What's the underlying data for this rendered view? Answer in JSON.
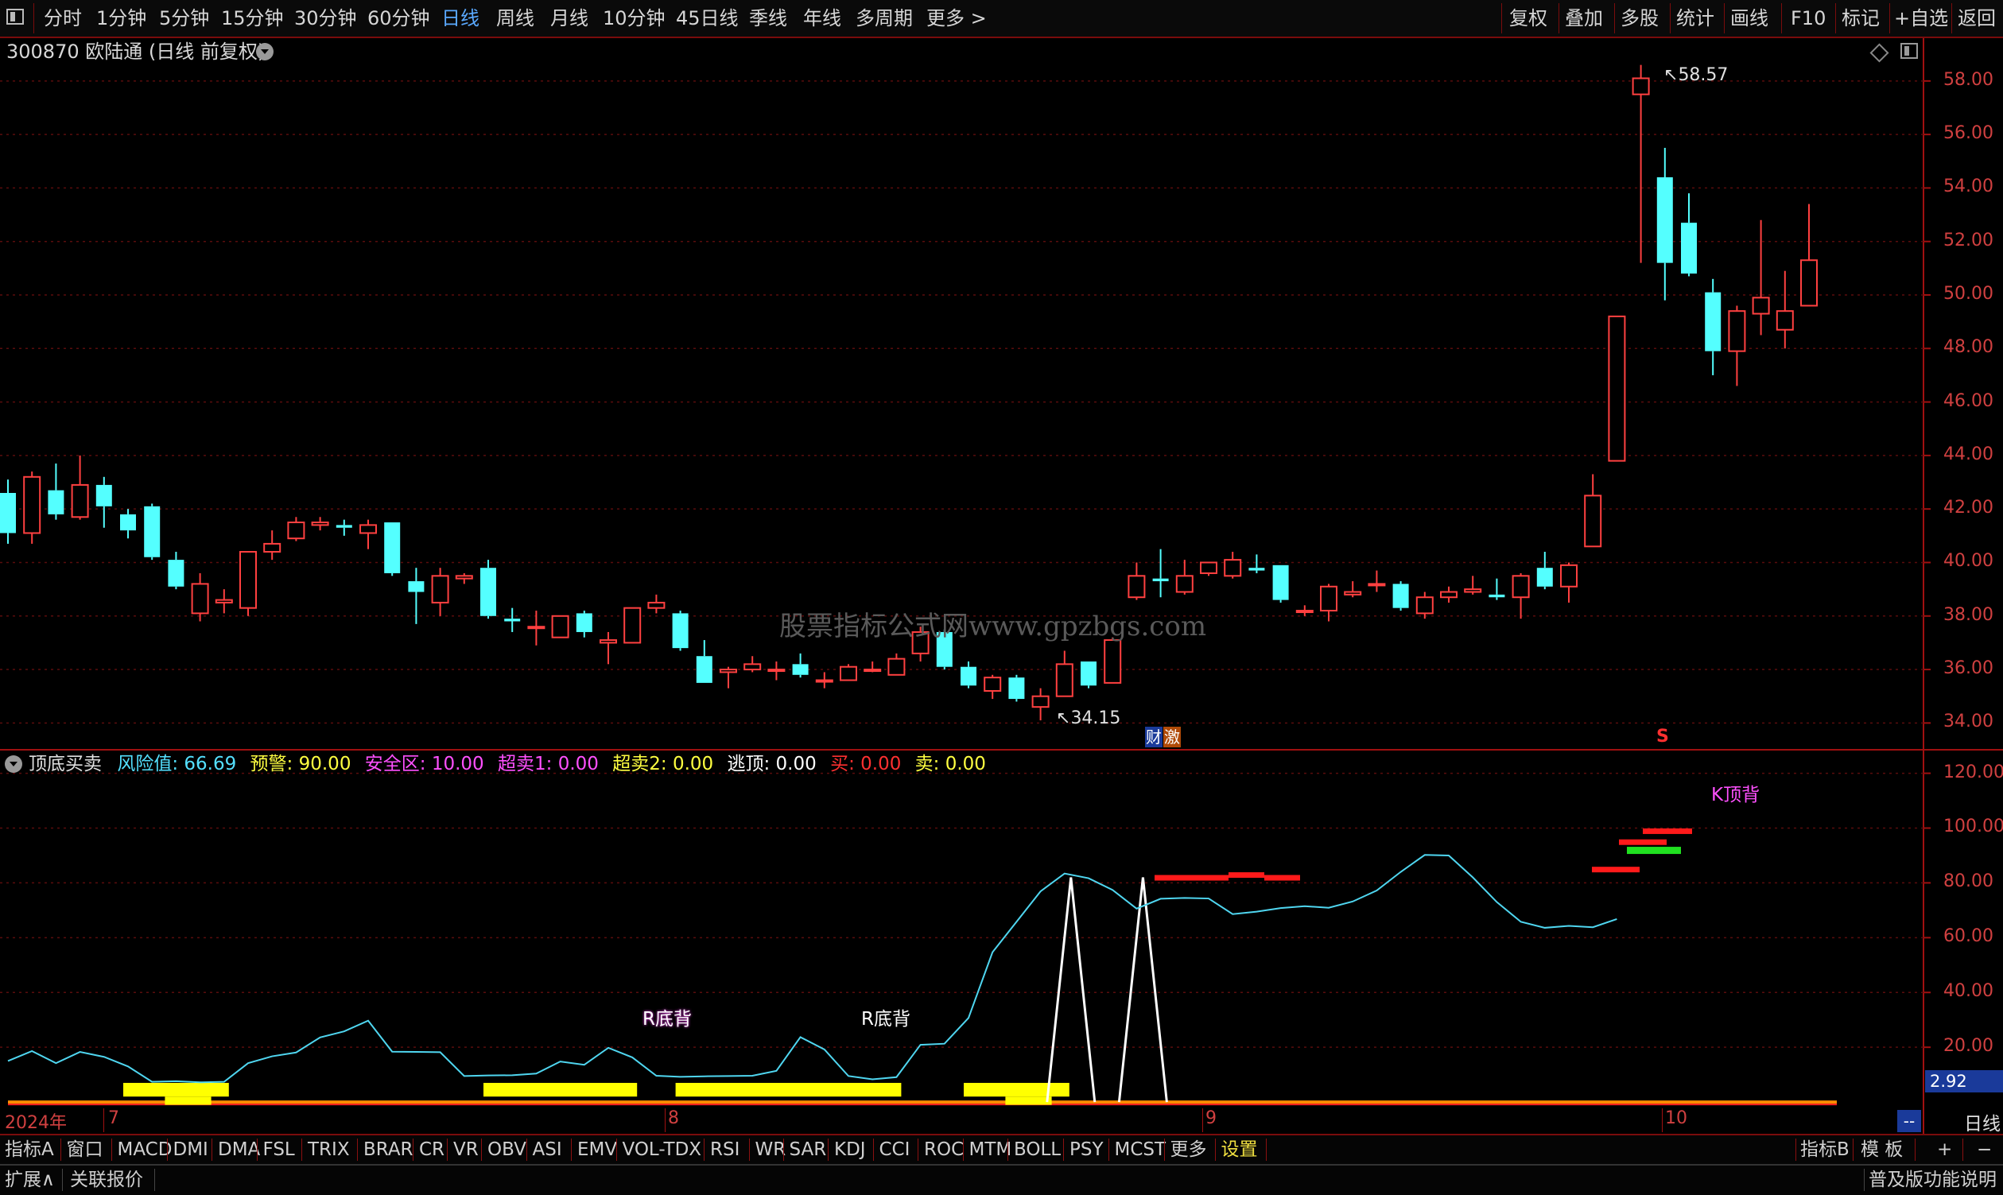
{
  "topbar": {
    "periods": [
      "分时",
      "1分钟",
      "5分钟",
      "15分钟",
      "30分钟",
      "60分钟",
      "日线",
      "周线",
      "月线",
      "10分钟",
      "45日线",
      "季线",
      "年线",
      "多周期",
      "更多 >"
    ],
    "active_period": "日线",
    "right_buttons": [
      "复权",
      "叠加",
      "多股",
      "统计",
      "画线",
      "F10",
      "标记",
      "+自选",
      "返回"
    ]
  },
  "main_chart": {
    "title": "300870 欧陆通 (日线 前复权)",
    "high_label": "58.57",
    "low_label": "34.15",
    "watermark": "股票指标公式网www.gpzbgs.com",
    "marker_cai": "财",
    "marker_ji": "激",
    "marker_s": "S",
    "y_ticks": [
      "58.00",
      "56.00",
      "54.00",
      "52.00",
      "50.00",
      "48.00",
      "46.00",
      "44.00",
      "42.00",
      "40.00",
      "38.00",
      "36.00",
      "34.00"
    ],
    "up_color": "#ff4040",
    "down_color": "#54ffff"
  },
  "chart_data": [
    {
      "type": "candlestick",
      "ylim": [
        33.0,
        59.6
      ],
      "candles": [
        {
          "o": 42.6,
          "c": 41.1,
          "h": 43.1,
          "l": 40.7
        },
        {
          "o": 41.1,
          "c": 43.2,
          "h": 43.4,
          "l": 40.7
        },
        {
          "o": 42.7,
          "c": 41.8,
          "h": 43.7,
          "l": 41.6
        },
        {
          "o": 41.7,
          "c": 42.9,
          "h": 44.0,
          "l": 41.6
        },
        {
          "o": 42.9,
          "c": 42.1,
          "h": 43.2,
          "l": 41.3
        },
        {
          "o": 41.8,
          "c": 41.2,
          "h": 42.0,
          "l": 40.9
        },
        {
          "o": 42.1,
          "c": 40.2,
          "h": 42.2,
          "l": 40.1
        },
        {
          "o": 40.1,
          "c": 39.1,
          "h": 40.4,
          "l": 39.0
        },
        {
          "o": 38.1,
          "c": 39.2,
          "h": 39.6,
          "l": 37.8
        },
        {
          "o": 38.5,
          "c": 38.6,
          "h": 39.0,
          "l": 38.1
        },
        {
          "o": 38.3,
          "c": 40.4,
          "h": 40.4,
          "l": 38.0
        },
        {
          "o": 40.4,
          "c": 40.7,
          "h": 41.2,
          "l": 40.1
        },
        {
          "o": 40.9,
          "c": 41.5,
          "h": 41.7,
          "l": 40.8
        },
        {
          "o": 41.4,
          "c": 41.5,
          "h": 41.7,
          "l": 41.2
        },
        {
          "o": 41.4,
          "c": 41.3,
          "h": 41.6,
          "l": 41.0
        },
        {
          "o": 41.1,
          "c": 41.4,
          "h": 41.6,
          "l": 40.5
        },
        {
          "o": 41.5,
          "c": 39.6,
          "h": 41.5,
          "l": 39.5
        },
        {
          "o": 39.3,
          "c": 38.9,
          "h": 39.8,
          "l": 37.7
        },
        {
          "o": 38.5,
          "c": 39.5,
          "h": 39.8,
          "l": 38.0
        },
        {
          "o": 39.4,
          "c": 39.5,
          "h": 39.6,
          "l": 39.2
        },
        {
          "o": 39.8,
          "c": 38.0,
          "h": 40.1,
          "l": 37.9
        },
        {
          "o": 37.9,
          "c": 37.8,
          "h": 38.3,
          "l": 37.4
        },
        {
          "o": 37.6,
          "c": 37.6,
          "h": 38.2,
          "l": 36.9
        },
        {
          "o": 37.2,
          "c": 38.0,
          "h": 38.0,
          "l": 37.2
        },
        {
          "o": 38.1,
          "c": 37.4,
          "h": 38.2,
          "l": 37.2
        },
        {
          "o": 37.0,
          "c": 37.1,
          "h": 37.4,
          "l": 36.2
        },
        {
          "o": 37.0,
          "c": 38.3,
          "h": 38.3,
          "l": 37.0
        },
        {
          "o": 38.3,
          "c": 38.5,
          "h": 38.8,
          "l": 38.1
        },
        {
          "o": 38.1,
          "c": 36.8,
          "h": 38.2,
          "l": 36.7
        },
        {
          "o": 36.5,
          "c": 35.5,
          "h": 37.1,
          "l": 35.5
        },
        {
          "o": 35.9,
          "c": 36.0,
          "h": 36.1,
          "l": 35.3
        },
        {
          "o": 36.0,
          "c": 36.2,
          "h": 36.5,
          "l": 35.9
        },
        {
          "o": 36.0,
          "c": 36.0,
          "h": 36.3,
          "l": 35.6
        },
        {
          "o": 36.2,
          "c": 35.8,
          "h": 36.6,
          "l": 35.7
        },
        {
          "o": 35.6,
          "c": 35.6,
          "h": 35.9,
          "l": 35.3
        },
        {
          "o": 35.6,
          "c": 36.1,
          "h": 36.2,
          "l": 35.6
        },
        {
          "o": 36.0,
          "c": 36.0,
          "h": 36.3,
          "l": 35.9
        },
        {
          "o": 35.8,
          "c": 36.4,
          "h": 36.6,
          "l": 35.8
        },
        {
          "o": 36.6,
          "c": 37.4,
          "h": 37.6,
          "l": 36.3
        },
        {
          "o": 37.4,
          "c": 36.1,
          "h": 37.5,
          "l": 36.0
        },
        {
          "o": 36.1,
          "c": 35.4,
          "h": 36.3,
          "l": 35.3
        },
        {
          "o": 35.2,
          "c": 35.7,
          "h": 35.8,
          "l": 34.9
        },
        {
          "o": 35.7,
          "c": 34.9,
          "h": 35.8,
          "l": 34.8
        },
        {
          "o": 34.6,
          "c": 35.0,
          "h": 35.3,
          "l": 34.1
        },
        {
          "o": 35.0,
          "c": 36.2,
          "h": 36.7,
          "l": 35.0
        },
        {
          "o": 36.3,
          "c": 35.4,
          "h": 36.3,
          "l": 35.3
        },
        {
          "o": 35.5,
          "c": 37.1,
          "h": 37.2,
          "l": 35.5
        },
        {
          "o": 38.7,
          "c": 39.5,
          "h": 40.0,
          "l": 38.6
        },
        {
          "o": 39.4,
          "c": 39.3,
          "h": 40.5,
          "l": 38.7
        },
        {
          "o": 38.9,
          "c": 39.5,
          "h": 40.1,
          "l": 38.8
        },
        {
          "o": 39.6,
          "c": 40.0,
          "h": 40.0,
          "l": 39.5
        },
        {
          "o": 39.5,
          "c": 40.1,
          "h": 40.4,
          "l": 39.4
        },
        {
          "o": 39.8,
          "c": 39.7,
          "h": 40.3,
          "l": 39.6
        },
        {
          "o": 39.9,
          "c": 38.6,
          "h": 39.9,
          "l": 38.5
        },
        {
          "o": 38.2,
          "c": 38.2,
          "h": 38.4,
          "l": 38.0
        },
        {
          "o": 38.2,
          "c": 39.1,
          "h": 39.2,
          "l": 37.8
        },
        {
          "o": 38.8,
          "c": 38.9,
          "h": 39.3,
          "l": 38.7
        },
        {
          "o": 39.2,
          "c": 39.2,
          "h": 39.7,
          "l": 38.9
        },
        {
          "o": 39.2,
          "c": 38.3,
          "h": 39.3,
          "l": 38.2
        },
        {
          "o": 38.1,
          "c": 38.7,
          "h": 38.9,
          "l": 37.9
        },
        {
          "o": 38.7,
          "c": 38.9,
          "h": 39.1,
          "l": 38.5
        },
        {
          "o": 38.9,
          "c": 39.0,
          "h": 39.5,
          "l": 38.8
        },
        {
          "o": 38.8,
          "c": 38.7,
          "h": 39.4,
          "l": 38.6
        },
        {
          "o": 38.7,
          "c": 39.5,
          "h": 39.6,
          "l": 37.9
        },
        {
          "o": 39.8,
          "c": 39.1,
          "h": 40.4,
          "l": 39.0
        },
        {
          "o": 39.1,
          "c": 39.9,
          "h": 40.0,
          "l": 38.5
        },
        {
          "o": 40.6,
          "c": 42.5,
          "h": 43.3,
          "l": 40.6
        },
        {
          "o": 43.8,
          "c": 49.2,
          "h": 49.2,
          "l": 43.8
        },
        {
          "o": 57.5,
          "c": 58.1,
          "h": 58.6,
          "l": 51.2
        },
        {
          "o": 54.4,
          "c": 51.2,
          "h": 55.5,
          "l": 49.8
        },
        {
          "o": 52.7,
          "c": 50.8,
          "h": 53.8,
          "l": 50.7
        },
        {
          "o": 50.1,
          "c": 47.9,
          "h": 50.6,
          "l": 47.0
        },
        {
          "o": 47.9,
          "c": 49.4,
          "h": 49.6,
          "l": 46.6
        },
        {
          "o": 49.3,
          "c": 49.9,
          "h": 52.8,
          "l": 48.5
        },
        {
          "o": 48.7,
          "c": 49.4,
          "h": 50.9,
          "l": 48.0
        },
        {
          "o": 49.6,
          "c": 51.3,
          "h": 53.4,
          "l": 49.6
        }
      ]
    },
    {
      "type": "line",
      "ylim": [
        -2,
        128
      ],
      "values": [
        15,
        18.6,
        14.2,
        18.3,
        16.5,
        13,
        7.4,
        7.6,
        7.2,
        7.4,
        14.2,
        16.7,
        18.1,
        23.6,
        25.8,
        29.7,
        18.4,
        18.3,
        18.2,
        9.5,
        9.7,
        9.8,
        10.4,
        14.8,
        13.6,
        19.8,
        16.3,
        9.6,
        9.2,
        9.4,
        9.5,
        9.6,
        11.4,
        23.7,
        19.2,
        9.5,
        8.3,
        9.1,
        20.9,
        21.3,
        30.7,
        54.7,
        65.8,
        76.9,
        83.4,
        81.7,
        77.4,
        70.6,
        74.2,
        74.5,
        74.3,
        68.6,
        69.5,
        70.8,
        71.5,
        70.9,
        73.2,
        77.2,
        84,
        90.2,
        90,
        82,
        73,
        65.8,
        63.6,
        64.3,
        63.8,
        66.8
      ],
      "x_labels": [
        "2024年",
        "7",
        "8",
        "9",
        "10"
      ]
    }
  ],
  "indicator": {
    "name": "顶底买卖",
    "items": [
      {
        "label": "风险值:",
        "value": "66.69"
      },
      {
        "label": "预警:",
        "value": "90.00"
      },
      {
        "label": "安全区:",
        "value": "10.00"
      },
      {
        "label": "超卖1:",
        "value": "0.00"
      },
      {
        "label": "超卖2:",
        "value": "0.00"
      },
      {
        "label": "逃顶:",
        "value": "0.00"
      },
      {
        "label": "买:",
        "value": "0.00"
      },
      {
        "label": "卖:",
        "value": "0.00"
      }
    ],
    "y_ticks": [
      "120.00",
      "100.00",
      "80.00",
      "60.00",
      "40.00",
      "20.00"
    ],
    "current_value": "2.92",
    "label_k_top": "K顶背",
    "label_r_bottom_1": "R底背",
    "label_r_bottom_2": "R底背",
    "x_axis": {
      "year": "2024年",
      "m7": "7",
      "m8": "8",
      "m9": "9",
      "m10": "10"
    },
    "period_label": "日线",
    "dash_label": "--"
  },
  "bottom_bar": {
    "items": [
      "指标A",
      "窗口",
      "MACD",
      "DMI",
      "DMA",
      "FSL",
      "TRIX",
      "BRAR",
      "CR",
      "VR",
      "OBV",
      "ASI",
      "EMV",
      "VOL-TDX",
      "RSI",
      "WR",
      "SAR",
      "KDJ",
      "CCI",
      "ROC",
      "MTM",
      "BOLL",
      "PSY",
      "MCST",
      "更多",
      "设置"
    ],
    "right_items": [
      "指标B",
      "模 板",
      "+",
      "−"
    ]
  },
  "status_bar": {
    "left": [
      "扩展∧",
      "关联报价"
    ],
    "right": "普及版功能说明"
  }
}
